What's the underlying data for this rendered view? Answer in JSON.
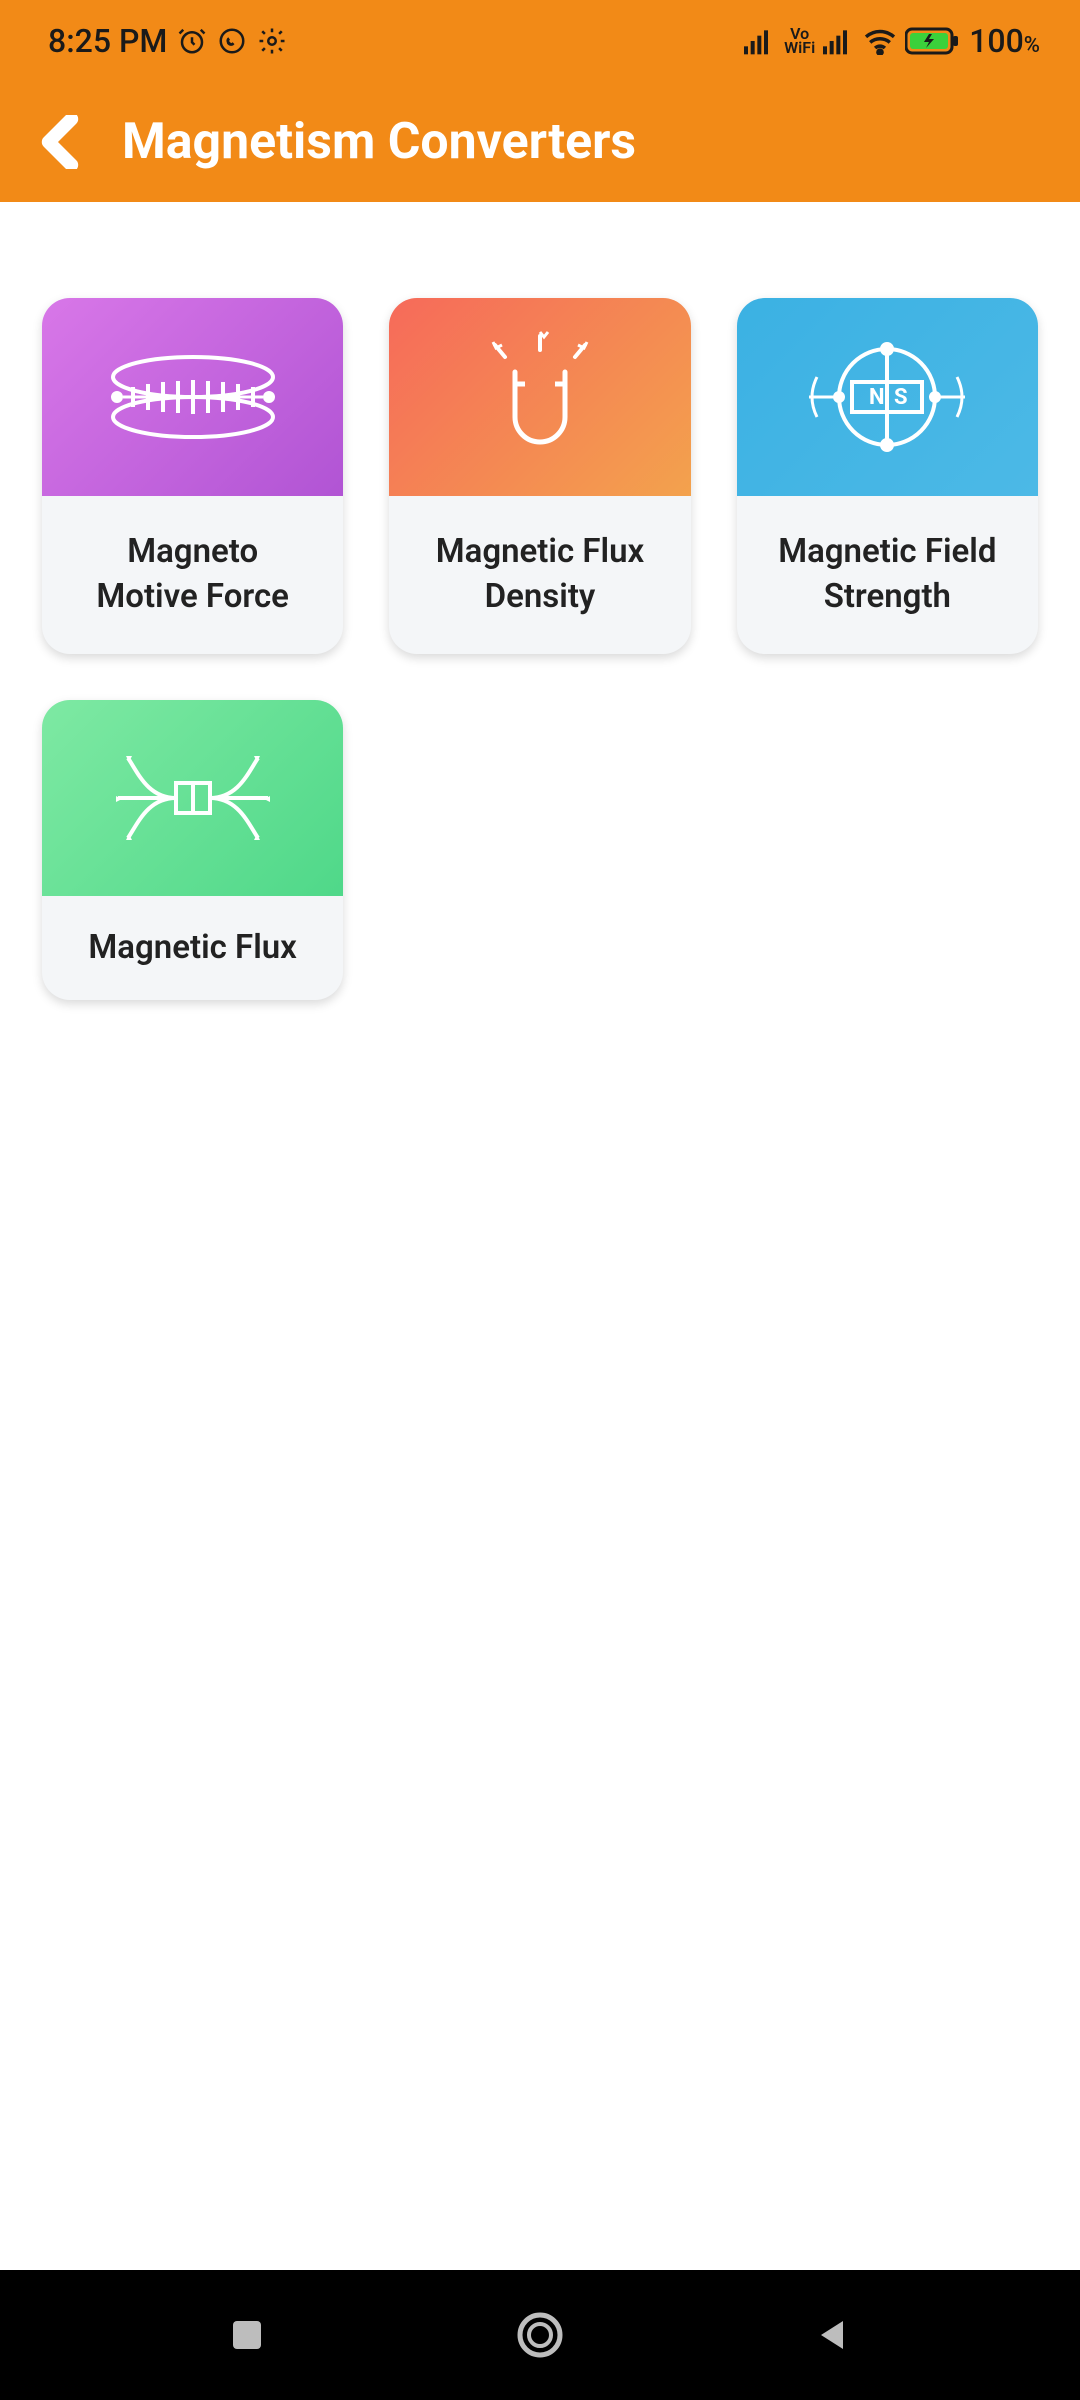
{
  "status": {
    "time": "8:25 PM",
    "battery": "100",
    "battery_suffix": "%",
    "vo_label": "Vo",
    "wifi_label": "WiFi"
  },
  "header": {
    "title": "Magnetism Converters"
  },
  "cards": [
    {
      "label": "Magneto\nMotive Force",
      "gradient": "g-purple",
      "icon": "coil-icon"
    },
    {
      "label": "Magnetic Flux\nDensity",
      "gradient": "g-orange",
      "icon": "magnet-icon"
    },
    {
      "label": "Magnetic Field\nStrength",
      "gradient": "g-blue",
      "icon": "ns-field-icon"
    },
    {
      "label": "Magnetic Flux",
      "gradient": "g-green",
      "icon": "flux-lines-icon"
    }
  ]
}
